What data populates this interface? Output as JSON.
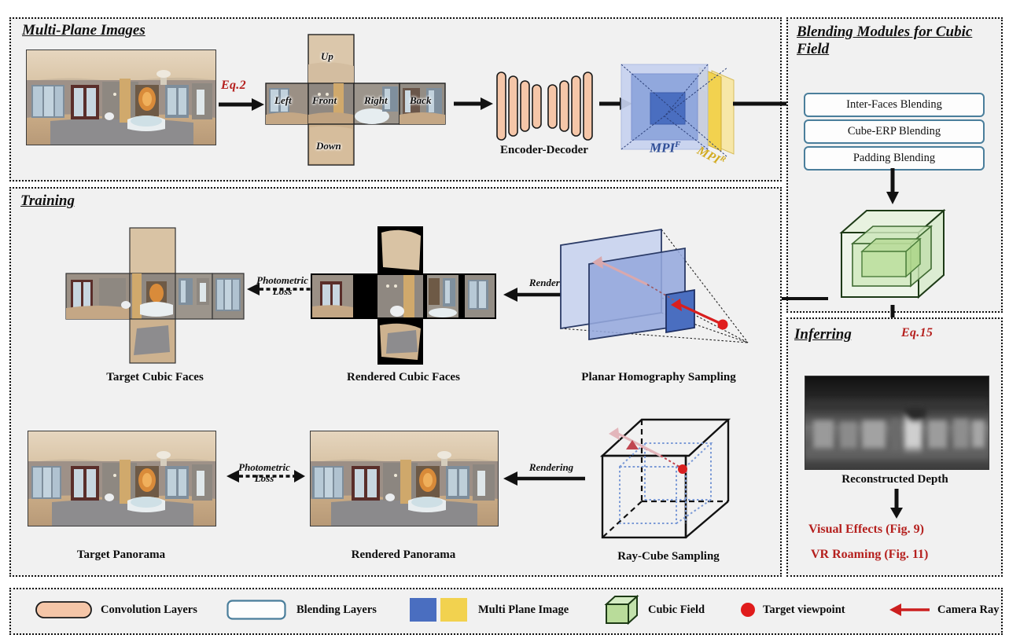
{
  "panels": {
    "multiplane": {
      "title": "Multi-Plane Images"
    },
    "blending": {
      "title": "Blending Modules for Cubic Field"
    },
    "training": {
      "title": "Training"
    },
    "inferring": {
      "title": "Inferring"
    }
  },
  "equations": {
    "eq2": "Eq.2",
    "eq15": "Eq.15"
  },
  "cube_faces": {
    "up": "Up",
    "down": "Down",
    "left": "Left",
    "front": "Front",
    "right": "Right",
    "back": "Back"
  },
  "network": {
    "label": "Encoder-Decoder",
    "bar_heights": [
      86,
      76,
      64,
      55,
      55,
      64,
      76,
      86
    ]
  },
  "mpi": {
    "front_label": "MPI",
    "front_sup": "F",
    "rear_label": "MPI",
    "rear_sup": "R",
    "front_color": "#4a6ec0",
    "rear_color": "#f2d24f"
  },
  "blending_modules": [
    {
      "label": "Inter-Faces Blending"
    },
    {
      "label": "Cube-ERP Blending"
    },
    {
      "label": "Padding Blending"
    }
  ],
  "training": {
    "target_cubic_faces": "Target Cubic Faces",
    "rendered_cubic_faces": "Rendered Cubic Faces",
    "planar_homography": "Planar Homography Sampling",
    "target_panorama": "Target Panorama",
    "rendered_panorama": "Rendered Panorama",
    "ray_cube": "Ray-Cube Sampling",
    "photometric_loss_line1": "Photometric",
    "photometric_loss_line2": "Loss",
    "rendering_label": "Rendering"
  },
  "inferring": {
    "reconstructed_depth": "Reconstructed Depth",
    "visual_effects": "Visual Effects (Fig. 9)",
    "vr_roaming": "VR Roaming (Fig. 11)"
  },
  "legend": [
    {
      "name": "convolution-layers",
      "label": "Convolution Layers",
      "icon": "pill",
      "color": "#f5c6a8"
    },
    {
      "name": "blending-layers",
      "label": "Blending Layers",
      "icon": "rounded-rect",
      "color": "#4a7e9b"
    },
    {
      "name": "multi-plane-image",
      "label": "Multi Plane Image",
      "icon": "two-squares",
      "color": "#4a6ec0",
      "color2": "#f2d24f"
    },
    {
      "name": "cubic-field",
      "label": "Cubic Field",
      "icon": "cube",
      "color": "#b9dc9a"
    },
    {
      "name": "target-viewpoint",
      "label": "Target viewpoint",
      "icon": "dot",
      "color": "#e01b1b"
    },
    {
      "name": "camera-ray",
      "label": "Camera Ray",
      "icon": "arrow",
      "color": "#cc1f1f"
    }
  ],
  "colors": {
    "accent_red": "#b5201e",
    "panel_bg": "#f1f1f1",
    "blend_border": "#4a7e9b",
    "cube_green": "#b9dc9a",
    "mpi_blue": "#4a6ec0",
    "mpi_yellow": "#f2d24f"
  }
}
